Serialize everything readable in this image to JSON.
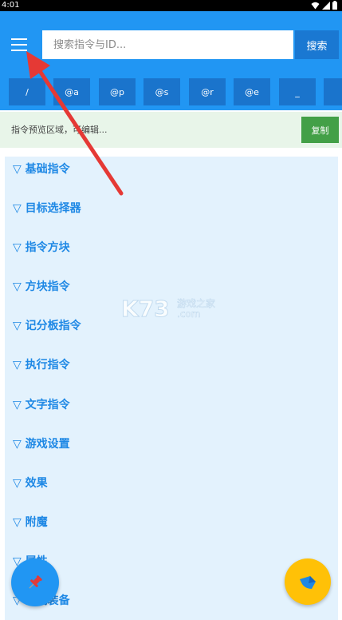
{
  "status_bar": {
    "time": "4:01",
    "icons": [
      "wifi-icon",
      "signal-icon",
      "battery-icon"
    ]
  },
  "header": {
    "menu_icon": "menu-icon",
    "search": {
      "placeholder": "搜索指令与ID...",
      "value": ""
    },
    "search_button_label": "搜索",
    "selector_buttons": [
      "/",
      "@a",
      "@p",
      "@s",
      "@r",
      "@e",
      "_"
    ]
  },
  "preview": {
    "text": "指令预览区域，可编辑...",
    "copy_button_label": "复制"
  },
  "categories": [
    "▽ 基础指令",
    "▽ 目标选择器",
    "▽ 指令方块",
    "▽ 方块指令",
    "▽ 记分板指令",
    "▽ 执行指令",
    "▽ 文字指令",
    "▽ 游戏设置",
    "▽ 效果",
    "▽ 附魔",
    "▽ 属性",
    "▽ 游戏装备"
  ],
  "watermark": {
    "logo": "K73",
    "line1": "游戏之家",
    "line2": ".com"
  },
  "fabs": {
    "left_icon": "pin-icon",
    "right_icon": "hat-icon"
  },
  "colors": {
    "primary": "#2196f3",
    "primary_dark": "#1a74cc",
    "accent": "#ffc107",
    "copy_green": "#43a047",
    "category_text": "#1e88e5",
    "panel_bg": "#e3f2fd",
    "preview_bg": "#e8f5e9",
    "annotation_arrow": "#e53935"
  }
}
